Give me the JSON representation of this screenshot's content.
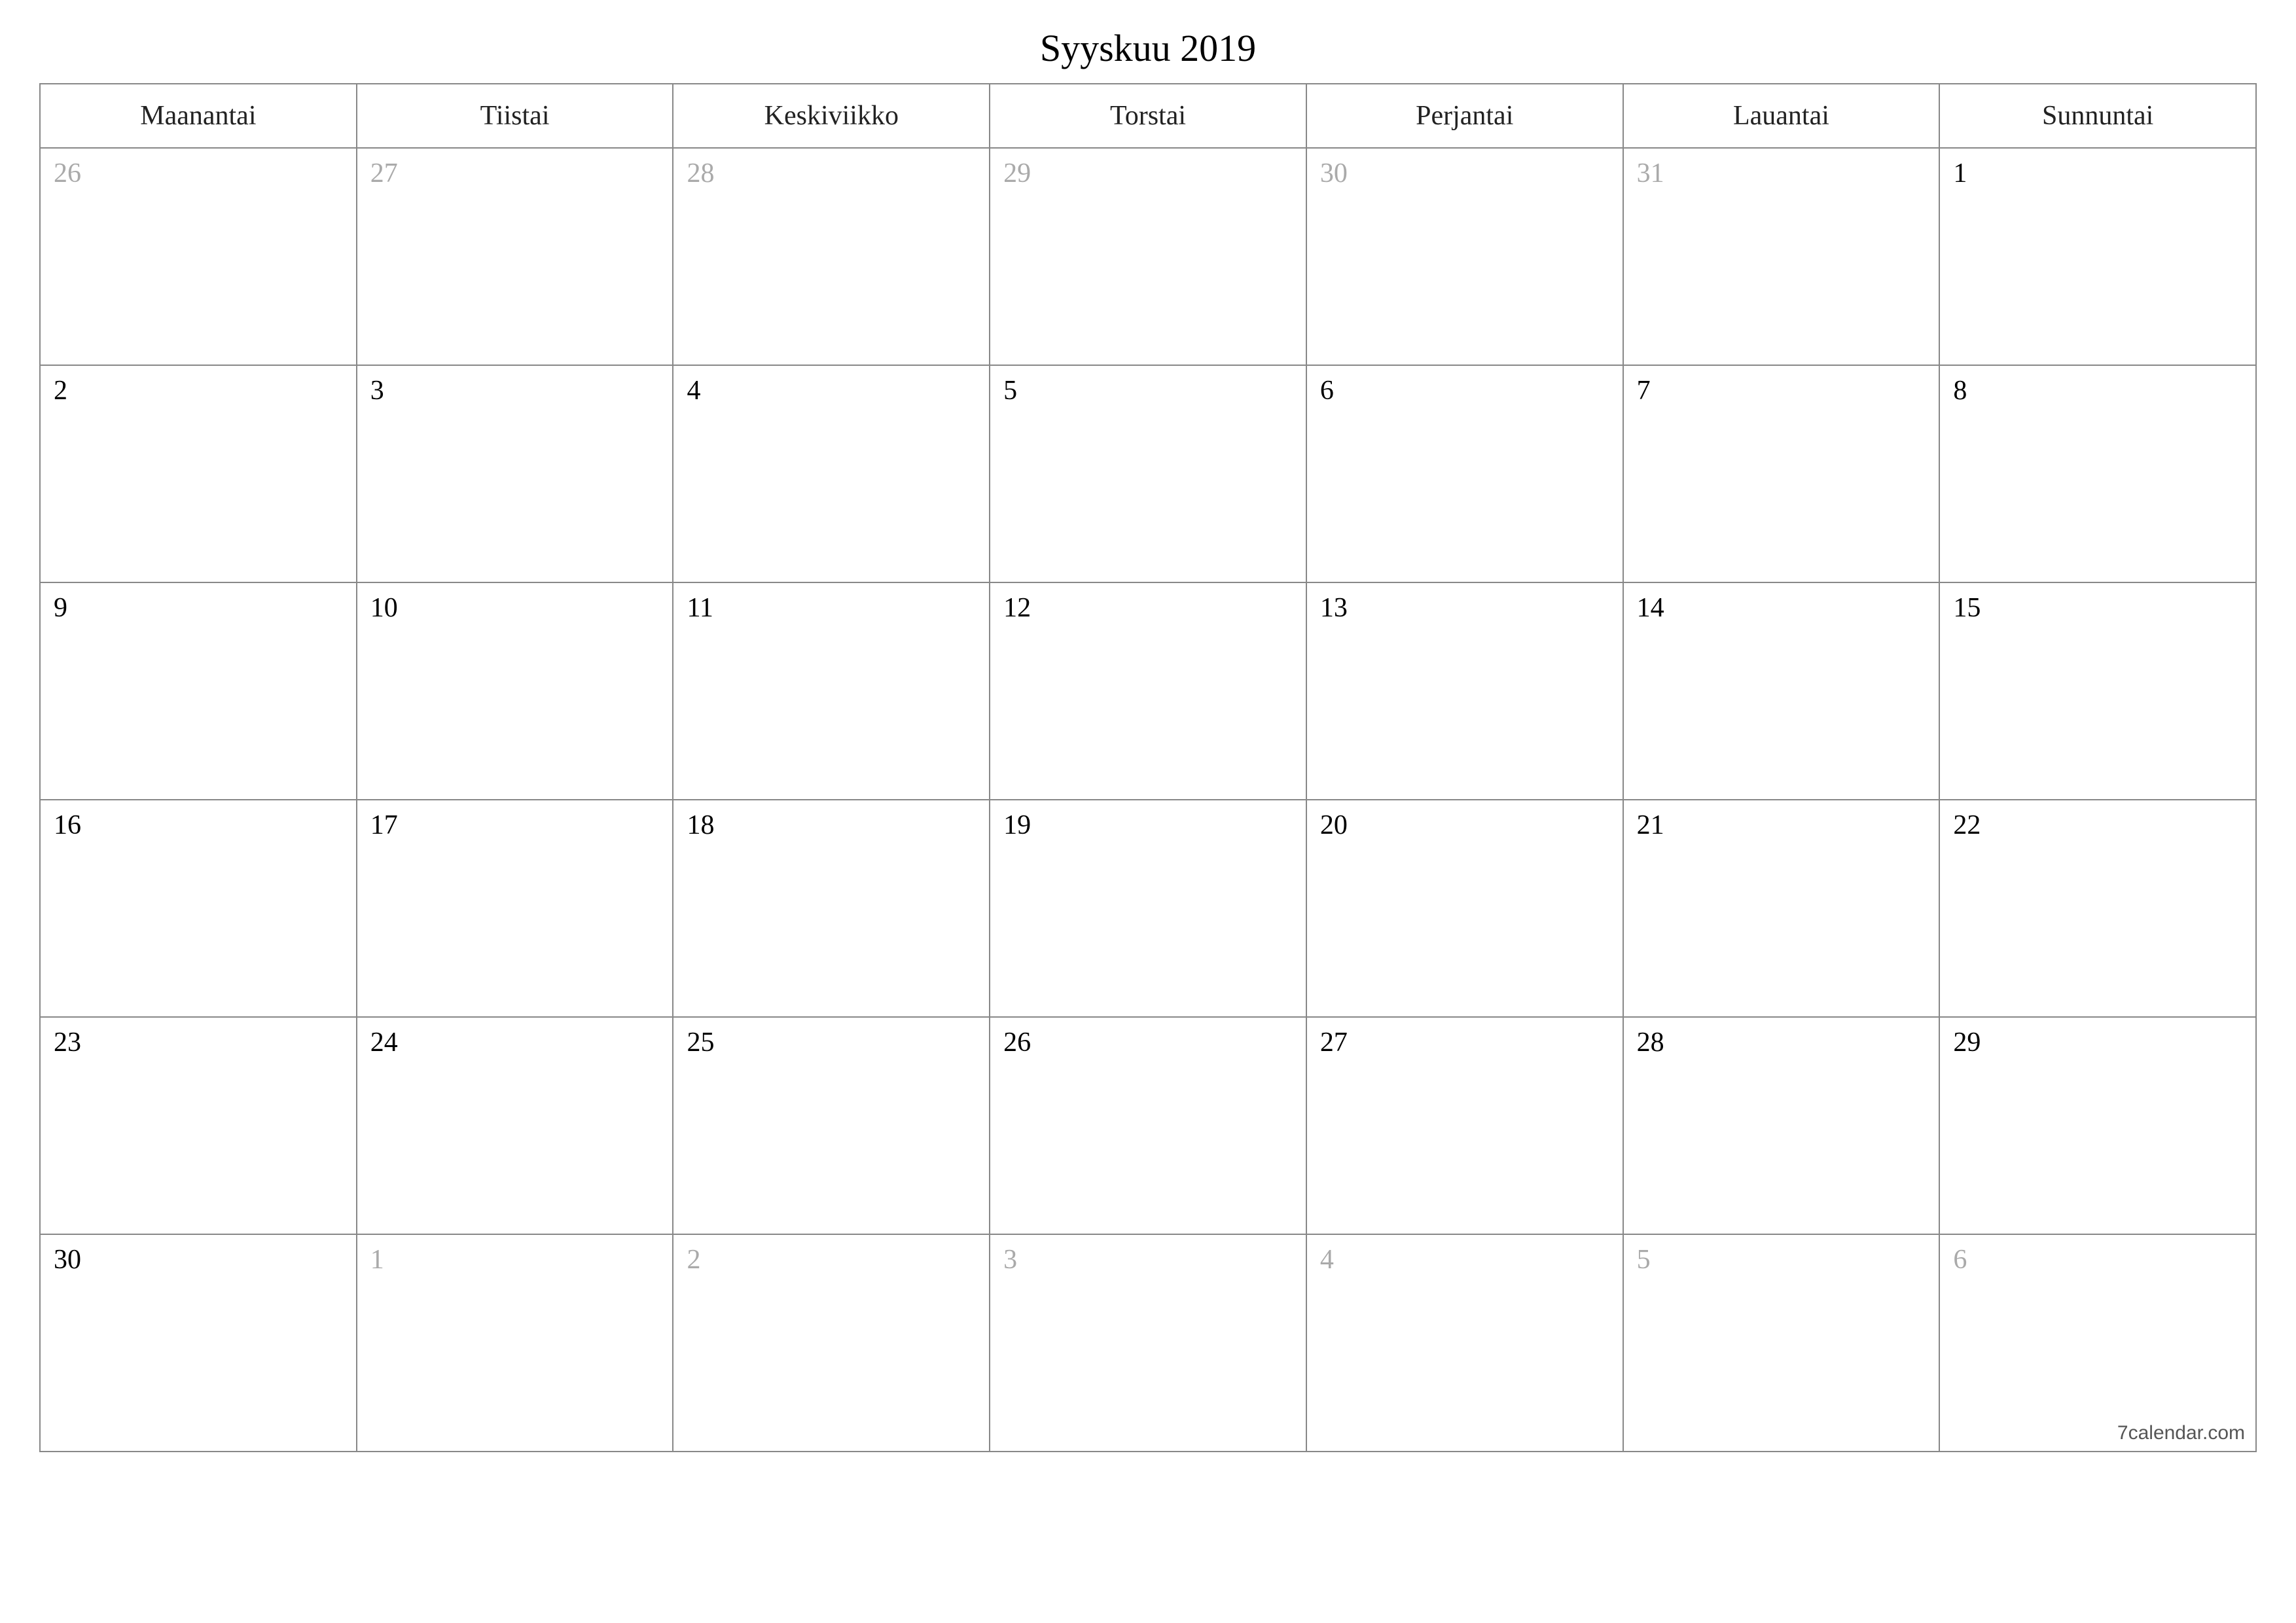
{
  "title": "Syyskuu 2019",
  "weekdays": [
    "Maanantai",
    "Tiistai",
    "Keskiviikko",
    "Torstai",
    "Perjantai",
    "Lauantai",
    "Sunnuntai"
  ],
  "weeks": [
    [
      {
        "day": "26",
        "muted": true
      },
      {
        "day": "27",
        "muted": true
      },
      {
        "day": "28",
        "muted": true
      },
      {
        "day": "29",
        "muted": true
      },
      {
        "day": "30",
        "muted": true
      },
      {
        "day": "31",
        "muted": true
      },
      {
        "day": "1",
        "muted": false
      }
    ],
    [
      {
        "day": "2",
        "muted": false
      },
      {
        "day": "3",
        "muted": false
      },
      {
        "day": "4",
        "muted": false
      },
      {
        "day": "5",
        "muted": false
      },
      {
        "day": "6",
        "muted": false
      },
      {
        "day": "7",
        "muted": false
      },
      {
        "day": "8",
        "muted": false
      }
    ],
    [
      {
        "day": "9",
        "muted": false
      },
      {
        "day": "10",
        "muted": false
      },
      {
        "day": "11",
        "muted": false
      },
      {
        "day": "12",
        "muted": false
      },
      {
        "day": "13",
        "muted": false
      },
      {
        "day": "14",
        "muted": false
      },
      {
        "day": "15",
        "muted": false
      }
    ],
    [
      {
        "day": "16",
        "muted": false
      },
      {
        "day": "17",
        "muted": false
      },
      {
        "day": "18",
        "muted": false
      },
      {
        "day": "19",
        "muted": false
      },
      {
        "day": "20",
        "muted": false
      },
      {
        "day": "21",
        "muted": false
      },
      {
        "day": "22",
        "muted": false
      }
    ],
    [
      {
        "day": "23",
        "muted": false
      },
      {
        "day": "24",
        "muted": false
      },
      {
        "day": "25",
        "muted": false
      },
      {
        "day": "26",
        "muted": false
      },
      {
        "day": "27",
        "muted": false
      },
      {
        "day": "28",
        "muted": false
      },
      {
        "day": "29",
        "muted": false
      }
    ],
    [
      {
        "day": "30",
        "muted": false
      },
      {
        "day": "1",
        "muted": true
      },
      {
        "day": "2",
        "muted": true
      },
      {
        "day": "3",
        "muted": true
      },
      {
        "day": "4",
        "muted": true
      },
      {
        "day": "5",
        "muted": true
      },
      {
        "day": "6",
        "muted": true
      }
    ]
  ],
  "footer": "7calendar.com"
}
